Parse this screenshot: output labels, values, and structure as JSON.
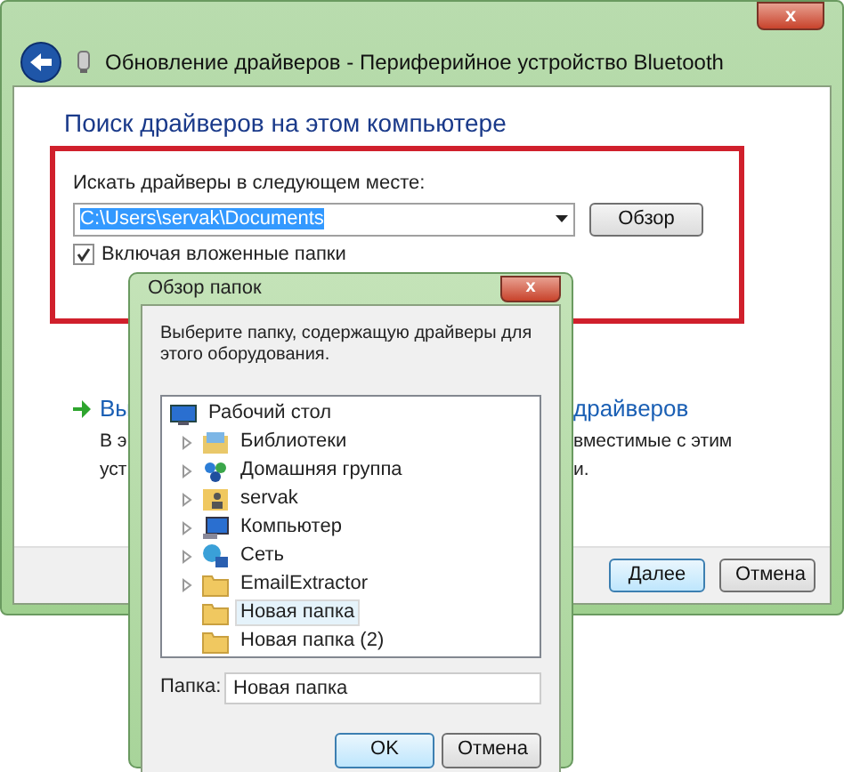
{
  "window": {
    "title": "Обновление драйверов - Периферийное устройство Bluetooth",
    "close": "x"
  },
  "heading": "Поиск драйверов на этом компьютере",
  "search": {
    "label": "Искать драйверы в следующем месте:",
    "value": "C:\\Users\\servak\\Documents",
    "text_selected": true,
    "browse_button": "Обзор"
  },
  "include_subfolders": {
    "label": "Включая вложенные папки",
    "checked": true
  },
  "option_left": [
    "Вы",
    "В э",
    "уст"
  ],
  "option_right": [
    "драйверов",
    "вместимые с этим",
    "и."
  ],
  "buttons": [
    "Далее",
    "Отмена"
  ],
  "dialog": {
    "title": "Обзор папок",
    "close": "x",
    "prompt": "Выберите папку, содержащую драйверы для этого оборудования.",
    "tree": [
      {
        "label": "Рабочий стол",
        "kind": "desktop",
        "selected": false,
        "children": [
          {
            "label": "Библиотеки",
            "kind": "library",
            "expandable": true,
            "selected": false
          },
          {
            "label": "Домашняя группа",
            "kind": "homegroup",
            "expandable": true,
            "selected": false
          },
          {
            "label": "servak",
            "kind": "user",
            "expandable": true,
            "selected": false
          },
          {
            "label": "Компьютер",
            "kind": "computer",
            "expandable": true,
            "selected": false
          },
          {
            "label": "Сеть",
            "kind": "network",
            "expandable": true,
            "selected": false
          },
          {
            "label": "EmailExtractor",
            "kind": "folder",
            "expandable": true,
            "selected": false
          },
          {
            "label": "Новая папка",
            "kind": "folder",
            "expandable": false,
            "selected": true
          },
          {
            "label": "Новая папка (2)",
            "kind": "folder",
            "expandable": false,
            "selected": false
          }
        ]
      }
    ],
    "folder_label": "Папка:",
    "folder_value": "Новая папка",
    "buttons": [
      "OK",
      "Отмена"
    ]
  }
}
